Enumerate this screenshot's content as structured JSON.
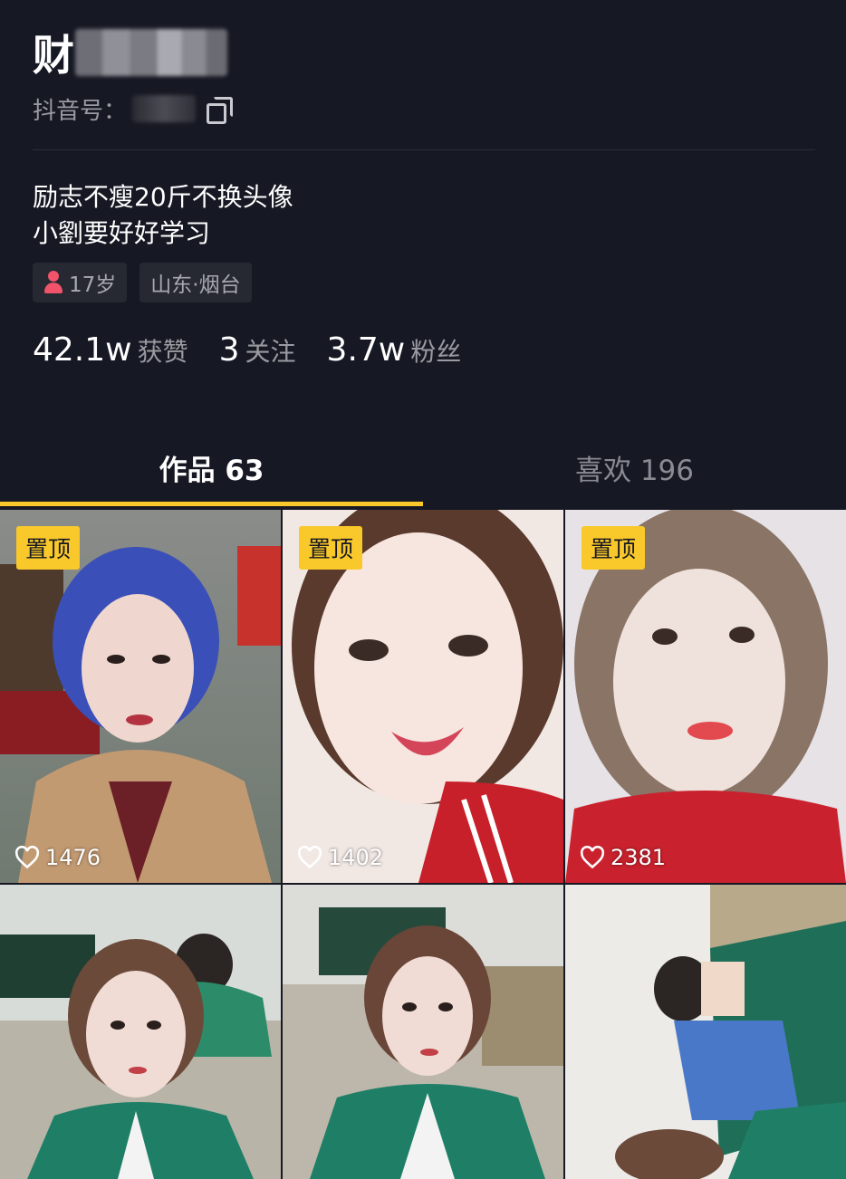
{
  "profile": {
    "name_visible": "财",
    "douyin_id_label": "抖音号：",
    "bio_line1": "励志不瘦20斤不换头像",
    "bio_line2": "小劉要好好学习",
    "tags": {
      "age": "17岁",
      "location": "山东·烟台"
    },
    "stats": [
      {
        "num": "42.1w",
        "label": "获赞"
      },
      {
        "num": "3",
        "label": "关注"
      },
      {
        "num": "3.7w",
        "label": "粉丝"
      }
    ]
  },
  "tabs": {
    "works": "作品 63",
    "likes": "喜欢 196"
  },
  "colors": {
    "background": "#161823",
    "accent": "#f9c82a",
    "female": "#f1536b"
  },
  "videos": [
    {
      "pinned": "置顶",
      "likes": "1476"
    },
    {
      "pinned": "置顶",
      "likes": "1402"
    },
    {
      "pinned": "置顶",
      "likes": "2381"
    },
    {
      "pinned": "",
      "likes": ""
    },
    {
      "pinned": "",
      "likes": ""
    },
    {
      "pinned": "",
      "likes": ""
    }
  ]
}
